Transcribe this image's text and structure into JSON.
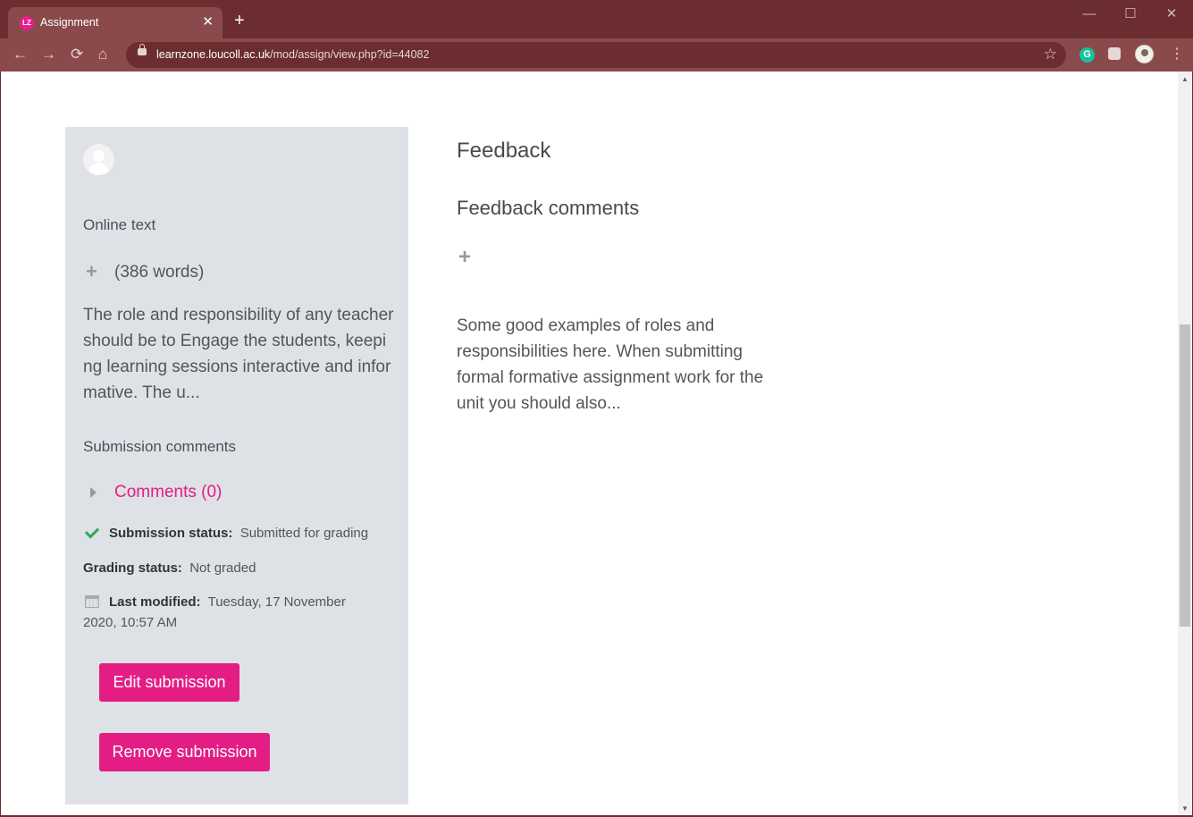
{
  "browser": {
    "tab_title": "Assignment",
    "favicon_text": "LZ",
    "close_glyph": "✕",
    "new_tab_glyph": "+",
    "url_host": "learnzone.loucoll.ac.uk",
    "url_path": "/mod/assign/view.php?id=44082",
    "nav": {
      "back": "←",
      "forward": "→",
      "reload": "⟳",
      "home": "⌂"
    },
    "star": "☆",
    "menu": "⋮",
    "ext_grammarly": "G",
    "window": {
      "minimize": "—",
      "maximize": "☐",
      "close": "✕"
    },
    "colors": {
      "frame": "#6b2d2f",
      "toolbar": "#8a4a4c"
    }
  },
  "submission": {
    "online_text_heading": "Online text",
    "word_count": "(386 words)",
    "online_text_excerpt": "The role and responsibility of any teacher should be to Engage the students, keeping learning sessions interactive and informative. The u...",
    "submission_comments_heading": "Submission comments",
    "comments_link": "Comments (0)",
    "status_label": "Submission status:",
    "status_value": "Submitted for grading",
    "grading_label": "Grading status:",
    "grading_value": "Not graded",
    "modified_label": "Last modified:",
    "modified_value_1": "Tuesday, 17 November",
    "modified_value_2": "2020, 10:57 AM",
    "edit_button": "Edit submission",
    "remove_button": "Remove submission",
    "plus_glyph": "+"
  },
  "feedback": {
    "heading": "Feedback",
    "comments_heading": "Feedback comments",
    "plus_glyph": "+",
    "text": "Some good examples of roles and responsibilities here. When submitting formal formative assignment work for the unit you should also..."
  },
  "scrollbar": {
    "up": "▲",
    "down": "▼"
  },
  "colors": {
    "accent": "#e31d84",
    "panel": "#dee2e6",
    "success": "#33a652"
  }
}
